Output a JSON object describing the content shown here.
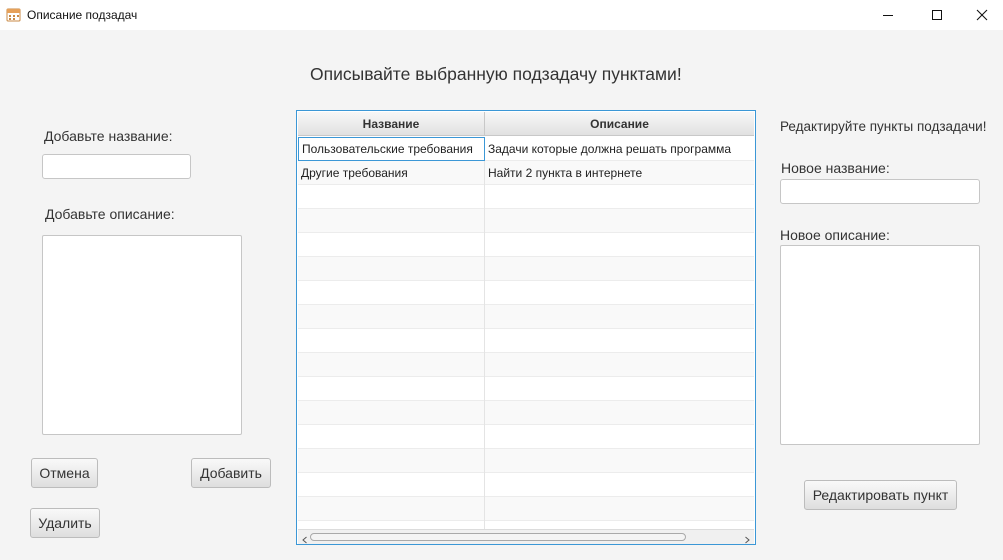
{
  "window": {
    "title": "Описание подзадач"
  },
  "heading": "Описывайте выбранную подзадачу пунктами!",
  "left_panel": {
    "name_label": "Добавьте название:",
    "name_value": "",
    "desc_label": "Добавьте описание:",
    "desc_value": "",
    "cancel_button": "Отмена",
    "add_button": "Добавить",
    "delete_button": "Удалить"
  },
  "table": {
    "columns": [
      "Название",
      "Описание"
    ],
    "rows": [
      {
        "name": "Пользовательские требования",
        "description": "Задачи которые должна решать программа"
      },
      {
        "name": "Другие требования",
        "description": "Найти 2 пункта в интернете"
      }
    ]
  },
  "right_panel": {
    "title": "Редактируйте пункты подзадачи!",
    "name_label": "Новое название:",
    "name_value": "",
    "desc_label": "Новое описание:",
    "desc_value": "",
    "edit_button": "Редактировать пункт"
  },
  "colors": {
    "accent": "#3b97d6",
    "background": "#f4f4f4"
  }
}
